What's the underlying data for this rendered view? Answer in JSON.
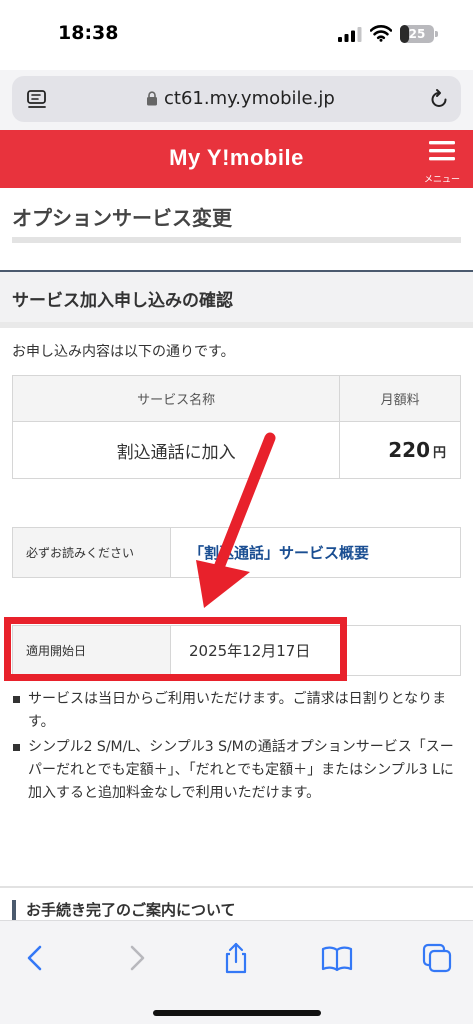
{
  "status_bar": {
    "time": "18:38",
    "battery": "25",
    "battery_level": 0.25
  },
  "browser": {
    "url": "ct61.my.ymobile.jp"
  },
  "header": {
    "brand": "My Y!mobile",
    "menu_label": "メニュー"
  },
  "page": {
    "title": "オプションサービス変更"
  },
  "section": {
    "title": "サービス加入申し込みの確認"
  },
  "intro": "お申し込み内容は以下の通りです。",
  "service_table": {
    "headers": [
      "サービス名称",
      "月額料"
    ],
    "rows": [
      {
        "name": "割込通話に加入",
        "price": "220",
        "unit": "円"
      }
    ]
  },
  "must_read": {
    "label": "必ずお読みください",
    "link": "「割込通話」サービス概要"
  },
  "start_date": {
    "label": "適用開始日",
    "value": "2025年12月17日"
  },
  "notes": [
    "サービスは当日からご利用いただけます。ご請求は日割りとなります。",
    "シンプル2 S/M/L、シンプル3 S/Mの通話オプションサービス「スーパーだれとでも定額＋」、「だれとでも定額＋」またはシンプル3 Lに加入すると追加料金なしで利用いただけます。"
  ],
  "footer_section": {
    "title": "お手続き完了のご案内について"
  },
  "colors": {
    "brand_red": "#e8333d",
    "highlight_red": "#e8212b",
    "link_blue": "#1a4e92",
    "ios_blue": "#3478f6"
  },
  "toolbar_icons": [
    "back-icon",
    "forward-icon",
    "share-icon",
    "bookmarks-icon",
    "tabs-icon"
  ]
}
